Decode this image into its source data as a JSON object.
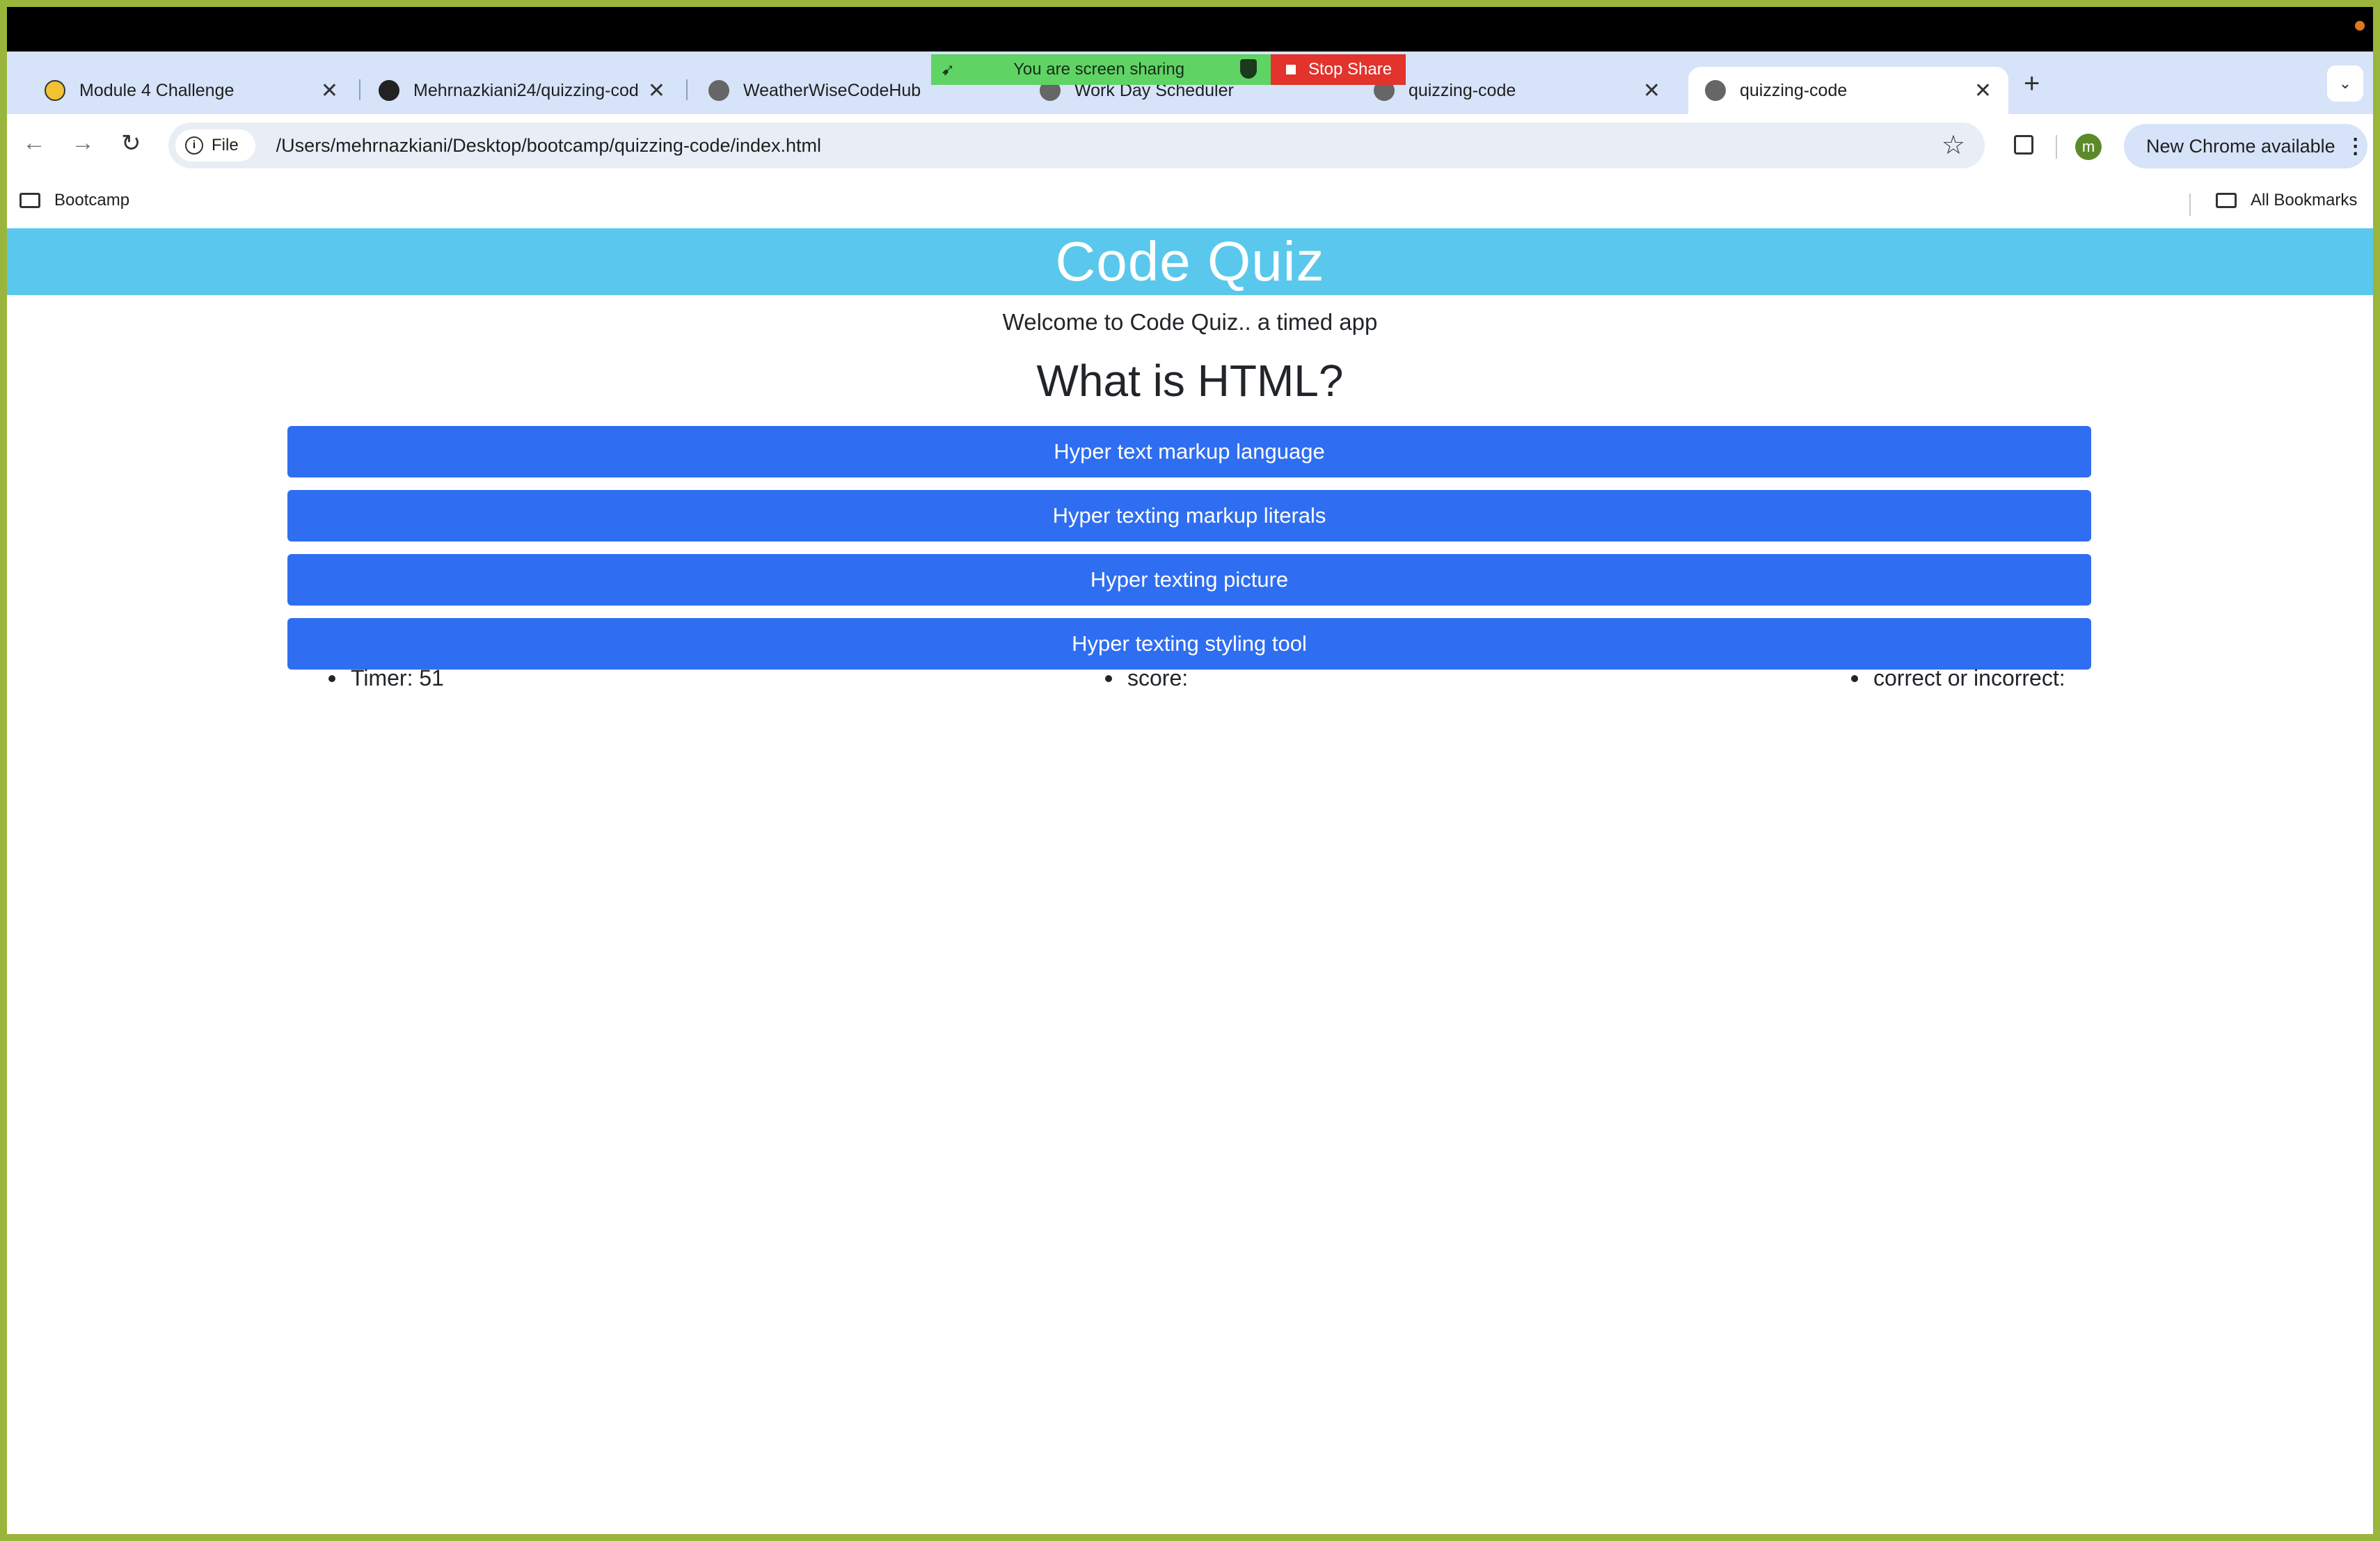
{
  "screen_share": {
    "message": "You are screen sharing",
    "stop_label": "Stop Share"
  },
  "tabs": [
    {
      "title": "Module 4 Challenge"
    },
    {
      "title": "Mehrnazkiani24/quizzing-code"
    },
    {
      "title": "WeatherWiseCodeHub"
    },
    {
      "title": "Work Day Scheduler"
    },
    {
      "title": "quizzing-code"
    },
    {
      "title": "quizzing-code"
    }
  ],
  "toolbar": {
    "chip_label": "File",
    "url": "/Users/mehrnazkiani/Desktop/bootcamp/quizzing-code/index.html",
    "avatar_letter": "m",
    "new_chrome_label": "New Chrome available"
  },
  "bookmarks": {
    "left_folder": "Bootcamp",
    "right_folder": "All Bookmarks"
  },
  "page": {
    "title": "Code Quiz",
    "welcome": "Welcome to Code Quiz.. a timed app",
    "question": "What is HTML?",
    "answers": [
      "Hyper text markup language",
      "Hyper texting markup literals",
      "Hyper texting picture",
      "Hyper texting styling tool"
    ],
    "timer": "Timer: 51",
    "score": "score:",
    "correctness": "correct or incorrect:"
  },
  "colors": {
    "header_bg": "#5ac8ec",
    "answer_bg": "#2f6ef0",
    "frame": "#9ab53c"
  },
  "icons": [
    "lego-favicon",
    "github-icon",
    "globe-icon",
    "close-icon",
    "plus-icon",
    "chevron-down-icon",
    "back-arrow-icon",
    "forward-arrow-icon",
    "reload-icon",
    "info-icon",
    "star-icon",
    "extensions-icon",
    "folder-icon",
    "stop-square-icon",
    "shield-icon",
    "leaf-icon"
  ]
}
